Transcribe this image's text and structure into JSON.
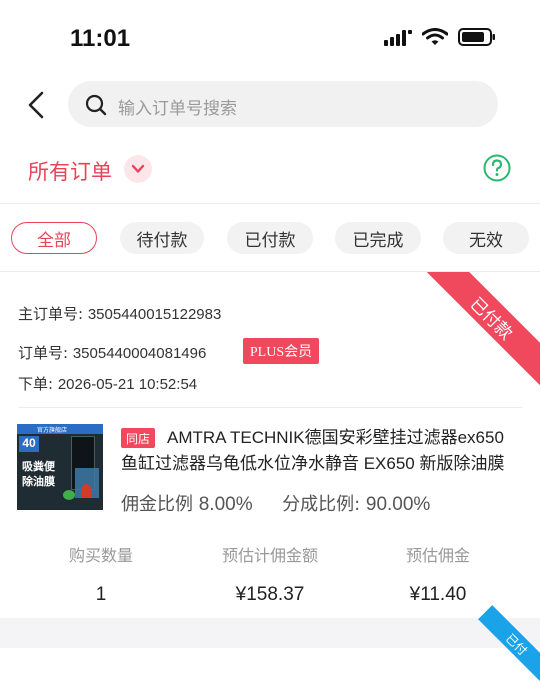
{
  "status_bar": {
    "time": "11:01"
  },
  "search": {
    "placeholder": "输入订单号搜索"
  },
  "filter": {
    "label": "所有订单"
  },
  "tabs": [
    {
      "label": "全部",
      "active": true
    },
    {
      "label": "待付款"
    },
    {
      "label": "已付款"
    },
    {
      "label": "已完成"
    },
    {
      "label": "无效"
    }
  ],
  "order": {
    "status_ribbon": "已付款",
    "main_order_label": "主订单号:",
    "main_order_no": "3505440015122983",
    "order_label": "订单号:",
    "order_no": "3505440004081496",
    "plus_badge": "PLUS会员",
    "placed_label": "下单:",
    "placed_time": "2026-05-21 10:52:54",
    "product": {
      "shop_tag": "同店",
      "title": "AMTRA TECHNIK德国安彩壁挂过滤器ex650鱼缸过滤器乌龟低水位净水静音 EX650 新版除油膜器...",
      "thumb_text": {
        "top": "40",
        "line1": "吸粪便",
        "line2": "除油膜",
        "badge": "官方旗舰店"
      }
    },
    "commission_rate_label": "佣金比例",
    "commission_rate": "8.00%",
    "share_rate_label": "分成比例:",
    "share_rate": "90.00%",
    "stats": [
      {
        "label": "购买数量",
        "value": "1"
      },
      {
        "label": "预估计佣金额",
        "value": "¥158.37"
      },
      {
        "label": "预估佣金",
        "value": "¥11.40"
      }
    ]
  },
  "next_order": {
    "status_ribbon": "已付"
  },
  "colors": {
    "accent": "#e94359",
    "help": "#2bb673",
    "next_ribbon": "#1aa3e8"
  }
}
